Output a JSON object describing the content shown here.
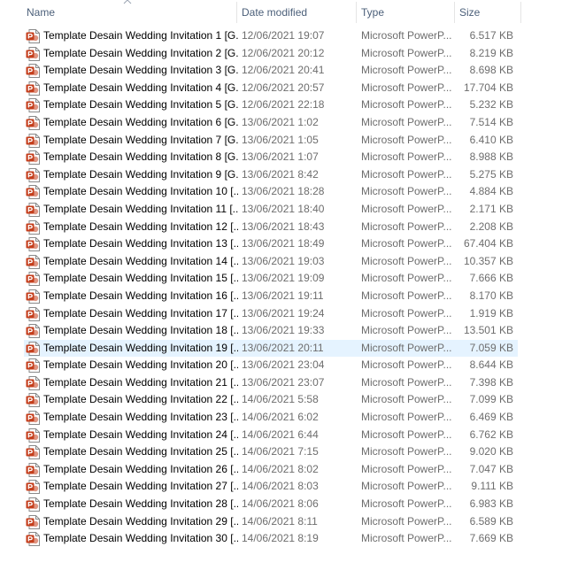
{
  "columns": {
    "name": "Name",
    "date": "Date modified",
    "type": "Type",
    "size": "Size"
  },
  "sort": {
    "column": "name",
    "direction": "ascending"
  },
  "selected_index": 18,
  "icon": {
    "name": "powerpoint-icon",
    "color": "#c43e1c"
  },
  "files": [
    {
      "name": "Template Desain Wedding Invitation 1 [G...",
      "date": "12/06/2021 19:07",
      "type": "Microsoft PowerP...",
      "size": "6.517 KB"
    },
    {
      "name": "Template Desain Wedding Invitation 2 [G...",
      "date": "12/06/2021 20:12",
      "type": "Microsoft PowerP...",
      "size": "8.219 KB"
    },
    {
      "name": "Template Desain Wedding Invitation 3 [G...",
      "date": "12/06/2021 20:41",
      "type": "Microsoft PowerP...",
      "size": "8.698 KB"
    },
    {
      "name": "Template Desain Wedding Invitation 4 [G...",
      "date": "12/06/2021 20:57",
      "type": "Microsoft PowerP...",
      "size": "17.704 KB"
    },
    {
      "name": "Template Desain Wedding Invitation 5 [G...",
      "date": "12/06/2021 22:18",
      "type": "Microsoft PowerP...",
      "size": "5.232 KB"
    },
    {
      "name": "Template Desain Wedding Invitation 6 [G...",
      "date": "13/06/2021 1:02",
      "type": "Microsoft PowerP...",
      "size": "7.514 KB"
    },
    {
      "name": "Template Desain Wedding Invitation 7 [G...",
      "date": "13/06/2021 1:05",
      "type": "Microsoft PowerP...",
      "size": "6.410 KB"
    },
    {
      "name": "Template Desain Wedding Invitation 8 [G...",
      "date": "13/06/2021 1:07",
      "type": "Microsoft PowerP...",
      "size": "8.988 KB"
    },
    {
      "name": "Template Desain Wedding Invitation 9 [G...",
      "date": "13/06/2021 8:42",
      "type": "Microsoft PowerP...",
      "size": "5.275 KB"
    },
    {
      "name": "Template Desain Wedding Invitation 10  [...",
      "date": "13/06/2021 18:28",
      "type": "Microsoft PowerP...",
      "size": "4.884 KB"
    },
    {
      "name": "Template Desain Wedding Invitation 11  [...",
      "date": "13/06/2021 18:40",
      "type": "Microsoft PowerP...",
      "size": "2.171 KB"
    },
    {
      "name": "Template Desain Wedding Invitation 12  [...",
      "date": "13/06/2021 18:43",
      "type": "Microsoft PowerP...",
      "size": "2.208 KB"
    },
    {
      "name": "Template Desain Wedding Invitation 13  [...",
      "date": "13/06/2021 18:49",
      "type": "Microsoft PowerP...",
      "size": "67.404 KB"
    },
    {
      "name": "Template Desain Wedding Invitation 14  [...",
      "date": "13/06/2021 19:03",
      "type": "Microsoft PowerP...",
      "size": "10.357 KB"
    },
    {
      "name": "Template Desain Wedding Invitation 15  [...",
      "date": "13/06/2021 19:09",
      "type": "Microsoft PowerP...",
      "size": "7.666 KB"
    },
    {
      "name": "Template Desain Wedding Invitation 16  [...",
      "date": "13/06/2021 19:11",
      "type": "Microsoft PowerP...",
      "size": "8.170 KB"
    },
    {
      "name": "Template Desain Wedding Invitation 17  [...",
      "date": "13/06/2021 19:24",
      "type": "Microsoft PowerP...",
      "size": "1.919 KB"
    },
    {
      "name": "Template Desain Wedding Invitation 18  [...",
      "date": "13/06/2021 19:33",
      "type": "Microsoft PowerP...",
      "size": "13.501 KB"
    },
    {
      "name": "Template Desain Wedding Invitation 19  [...",
      "date": "13/06/2021 20:11",
      "type": "Microsoft PowerP...",
      "size": "7.059 KB"
    },
    {
      "name": "Template Desain Wedding Invitation 20  [...",
      "date": "13/06/2021 23:04",
      "type": "Microsoft PowerP...",
      "size": "8.644 KB"
    },
    {
      "name": "Template Desain Wedding Invitation 21  [...",
      "date": "13/06/2021 23:07",
      "type": "Microsoft PowerP...",
      "size": "7.398 KB"
    },
    {
      "name": "Template Desain Wedding Invitation 22  [...",
      "date": "14/06/2021 5:58",
      "type": "Microsoft PowerP...",
      "size": "7.099 KB"
    },
    {
      "name": "Template Desain Wedding Invitation 23  [...",
      "date": "14/06/2021 6:02",
      "type": "Microsoft PowerP...",
      "size": "6.469 KB"
    },
    {
      "name": "Template Desain Wedding Invitation 24  [...",
      "date": "14/06/2021 6:44",
      "type": "Microsoft PowerP...",
      "size": "6.762 KB"
    },
    {
      "name": "Template Desain Wedding Invitation 25  [...",
      "date": "14/06/2021 7:15",
      "type": "Microsoft PowerP...",
      "size": "9.020 KB"
    },
    {
      "name": "Template Desain Wedding Invitation 26  [...",
      "date": "14/06/2021 8:02",
      "type": "Microsoft PowerP...",
      "size": "7.047 KB"
    },
    {
      "name": "Template Desain Wedding Invitation 27  [...",
      "date": "14/06/2021 8:03",
      "type": "Microsoft PowerP...",
      "size": "9.111 KB"
    },
    {
      "name": "Template Desain Wedding Invitation 28  [...",
      "date": "14/06/2021 8:06",
      "type": "Microsoft PowerP...",
      "size": "6.983 KB"
    },
    {
      "name": "Template Desain Wedding Invitation 29  [...",
      "date": "14/06/2021 8:11",
      "type": "Microsoft PowerP...",
      "size": "6.589 KB"
    },
    {
      "name": "Template Desain Wedding Invitation 30  [...",
      "date": "14/06/2021 8:19",
      "type": "Microsoft PowerP...",
      "size": "7.669 KB"
    }
  ]
}
